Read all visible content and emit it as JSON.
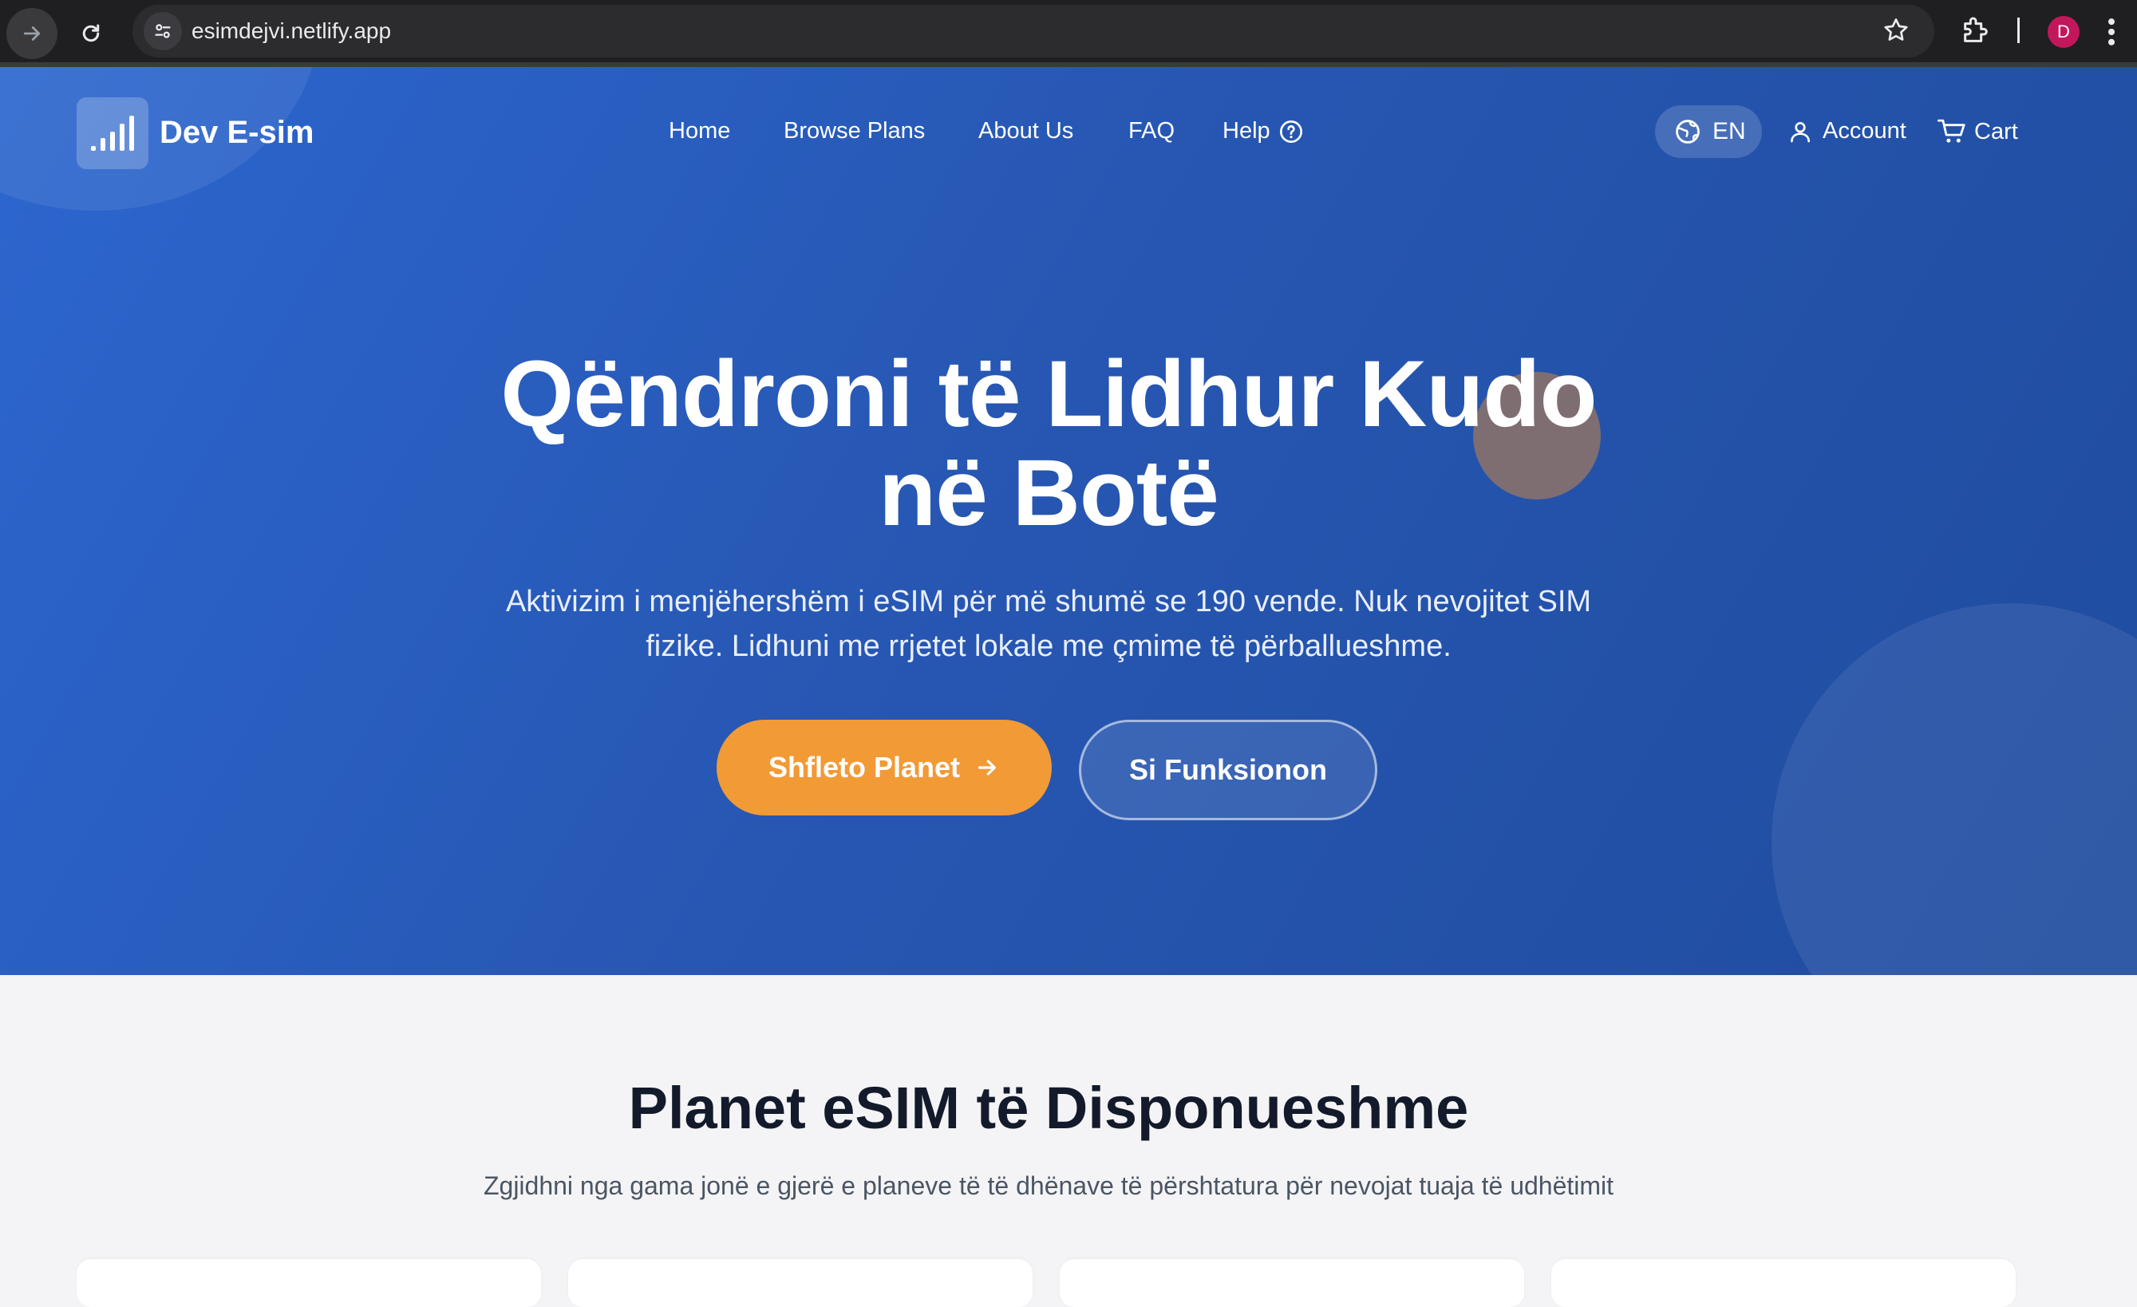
{
  "browser": {
    "url": "esimdejvi.netlify.app",
    "profile_initial": "D"
  },
  "header": {
    "brand": "Dev E-sim",
    "nav": [
      {
        "label": "Home"
      },
      {
        "label": "Browse Plans"
      },
      {
        "label": "About Us"
      },
      {
        "label": "FAQ"
      },
      {
        "label": "Help"
      }
    ],
    "language": "EN",
    "account_label": "Account",
    "cart_label": "Cart"
  },
  "hero": {
    "headline_line1": "Qëndroni të Lidhur Kudo",
    "headline_line2": "në Botë",
    "subtitle_line1": "Aktivizim i menjëhershëm i eSIM për më shumë se 190 vende. Nuk nevojitet SIM",
    "subtitle_line2": "fizike. Lidhuni me rrjetet lokale me çmime të përballueshme.",
    "primary_cta": "Shfleto Planet",
    "secondary_cta": "Si Funksionon"
  },
  "plans": {
    "title": "Planet eSIM të Disponueshme",
    "subtitle": "Zgjidhni nga gama jonë e gjerë e planeve të të dhënave të përshtatura për nevojat tuaja të udhëtimit"
  },
  "colors": {
    "hero_gradient_start": "#2c66cf",
    "hero_gradient_end": "#1f4c9e",
    "primary_button": "#f19a36",
    "section_bg": "#f4f4f6",
    "title_text": "#131a2b"
  },
  "icons": [
    "back-arrow-icon",
    "reload-icon",
    "site-settings-icon",
    "star-icon",
    "extensions-icon",
    "kebab-menu-icon",
    "signal-bars-icon",
    "help-circle-icon",
    "globe-icon",
    "user-icon",
    "cart-icon",
    "arrow-right-icon"
  ]
}
